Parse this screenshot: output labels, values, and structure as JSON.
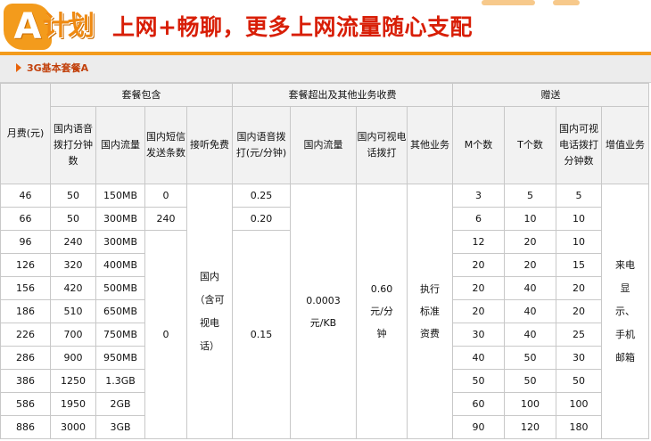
{
  "banner": {
    "logo_letter": "A",
    "logo_text": "计划",
    "headline": "上网+畅聊，更多上网流量随心支配"
  },
  "section": {
    "title": "3G基本套餐A"
  },
  "table": {
    "groups": {
      "included": "套餐包含",
      "overage": "套餐超出及其他业务收费",
      "gifts": "赠送"
    },
    "columns": {
      "fee": "月费(元)",
      "voice_min": "国内语音拨打分钟数",
      "data": "国内流量",
      "sms": "国内短信发送条数",
      "free_answer": "接听免费",
      "voice_rate": "国内语音拨打(元/分钟)",
      "data_rate": "国内流量",
      "video_call": "国内可视电话拨打",
      "other": "其他业务",
      "m_count": "M个数",
      "t_count": "T个数",
      "video_min": "国内可视电话拨打分钟数",
      "vas": "增值业务"
    },
    "rows": [
      {
        "fee": "46",
        "voice": "50",
        "data": "150MB",
        "m": "3",
        "t": "5",
        "video": "5"
      },
      {
        "fee": "66",
        "voice": "50",
        "data": "300MB",
        "m": "6",
        "t": "10",
        "video": "10"
      },
      {
        "fee": "96",
        "voice": "240",
        "data": "300MB",
        "m": "12",
        "t": "20",
        "video": "10"
      },
      {
        "fee": "126",
        "voice": "320",
        "data": "400MB",
        "m": "20",
        "t": "20",
        "video": "15"
      },
      {
        "fee": "156",
        "voice": "420",
        "data": "500MB",
        "m": "20",
        "t": "40",
        "video": "20"
      },
      {
        "fee": "186",
        "voice": "510",
        "data": "650MB",
        "m": "20",
        "t": "40",
        "video": "20"
      },
      {
        "fee": "226",
        "voice": "700",
        "data": "750MB",
        "m": "30",
        "t": "40",
        "video": "25"
      },
      {
        "fee": "286",
        "voice": "900",
        "data": "950MB",
        "m": "40",
        "t": "50",
        "video": "30"
      },
      {
        "fee": "386",
        "voice": "1250",
        "data": "1.3GB",
        "m": "50",
        "t": "50",
        "video": "50"
      },
      {
        "fee": "586",
        "voice": "1950",
        "data": "2GB",
        "m": "60",
        "t": "100",
        "video": "100"
      },
      {
        "fee": "886",
        "voice": "3000",
        "data": "3GB",
        "m": "90",
        "t": "120",
        "video": "180"
      }
    ],
    "sms_row1": "0",
    "sms_row2": "240",
    "sms_rest": "0",
    "free_answer_text": "国内（含可视电话）",
    "voice_rate_row1": "0.25",
    "voice_rate_row2": "0.20",
    "voice_rate_rest": "0.15",
    "data_rate_text": "0.0003元/KB",
    "video_call_text": "0.60元/分钟",
    "other_text": "执行标准资费",
    "vas_text": "来电显示、手机邮箱"
  },
  "colors": {
    "accent": "#f39b1c",
    "headline": "#d81e06",
    "section_title": "#c2410c"
  }
}
